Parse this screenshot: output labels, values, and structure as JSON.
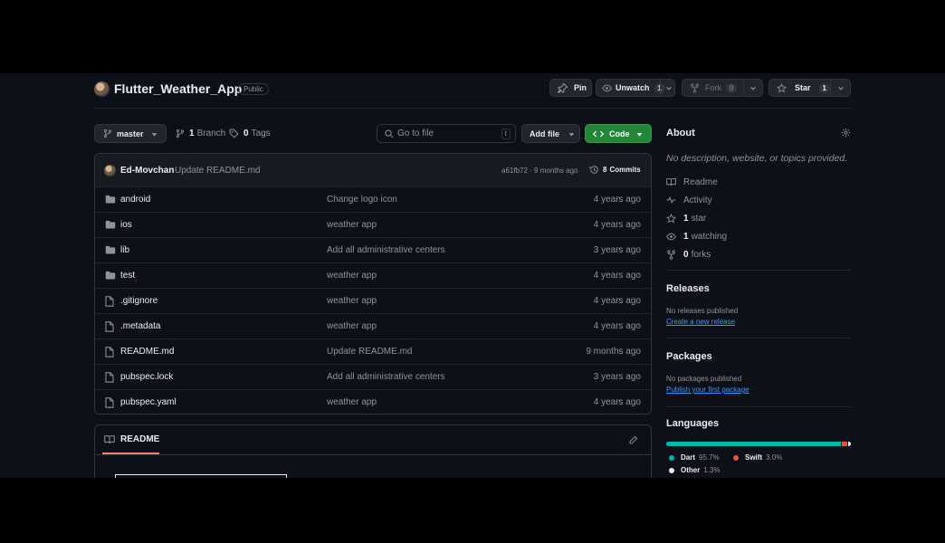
{
  "repo": {
    "name": "Flutter_Weather_App",
    "visibility": "Public"
  },
  "actions": {
    "pin": "Pin",
    "unwatch": "Unwatch",
    "watch_count": "1",
    "fork": "Fork",
    "fork_count": "0",
    "star": "Star",
    "star_count": "1"
  },
  "toolbar": {
    "branch": "master",
    "branches_count": "1",
    "branches_label": "Branch",
    "tags_count": "0",
    "tags_label": "Tags",
    "goto_placeholder": "Go to file",
    "goto_shortcut": "t",
    "add_file": "Add file",
    "code": "Code"
  },
  "commit": {
    "author": "Ed-Movchan",
    "message": "Update README.md",
    "hash_time": "a61fb72 · 9 months ago",
    "commits_count": "8",
    "commits_label": "Commits"
  },
  "files": [
    {
      "name": "android",
      "type": "folder",
      "message": "Change logo icon",
      "age": "4 years ago"
    },
    {
      "name": "ios",
      "type": "folder",
      "message": "weather app",
      "age": "4 years ago"
    },
    {
      "name": "lib",
      "type": "folder",
      "message": "Add all administrative centers",
      "age": "3 years ago"
    },
    {
      "name": "test",
      "type": "folder",
      "message": "weather app",
      "age": "4 years ago"
    },
    {
      "name": ".gitignore",
      "type": "file",
      "message": "weather app",
      "age": "4 years ago"
    },
    {
      "name": ".metadata",
      "type": "file",
      "message": "weather app",
      "age": "4 years ago"
    },
    {
      "name": "README.md",
      "type": "file",
      "message": "Update README.md",
      "age": "9 months ago"
    },
    {
      "name": "pubspec.lock",
      "type": "file",
      "message": "Add all administrative centers",
      "age": "3 years ago"
    },
    {
      "name": "pubspec.yaml",
      "type": "file",
      "message": "weather app",
      "age": "4 years ago"
    }
  ],
  "readme": {
    "tab": "README"
  },
  "about": {
    "title": "About",
    "description": "No description, website, or topics provided.",
    "readme": "Readme",
    "activity": "Activity",
    "stars_count": "1",
    "stars_label": "star",
    "watching_count": "1",
    "watching_label": "watching",
    "forks_count": "0",
    "forks_label": "forks"
  },
  "releases": {
    "title": "Releases",
    "empty": "No releases published",
    "link": "Create a new release"
  },
  "packages": {
    "title": "Packages",
    "empty": "No packages published",
    "link": "Publish your first package"
  },
  "languages": {
    "title": "Languages",
    "items": [
      {
        "name": "Dart",
        "percent": "95.7%",
        "value": 95.7,
        "color": "#00b4ab"
      },
      {
        "name": "Swift",
        "percent": "3.0%",
        "value": 3.0,
        "color": "#f05138"
      },
      {
        "name": "Other",
        "percent": "1.3%",
        "value": 1.3,
        "color": "#ededed"
      }
    ]
  },
  "colors": {
    "bg": "#0d1117",
    "border": "#30363d",
    "code_button": "#238636",
    "link": "#4493f8",
    "readme_underline": "#f78166"
  }
}
